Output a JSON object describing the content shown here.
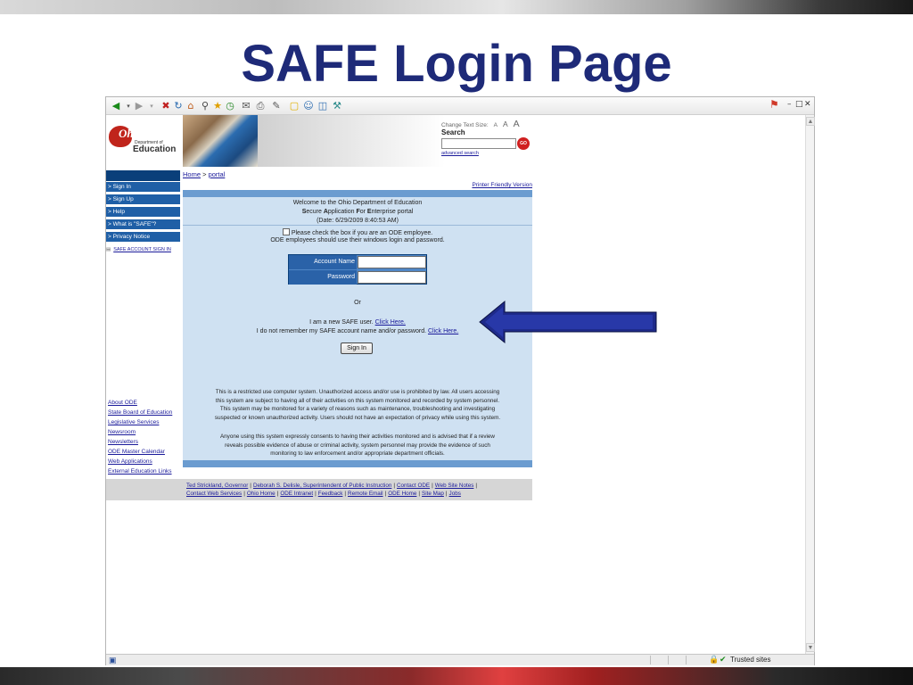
{
  "slide": {
    "title": "SAFE Login Page",
    "colors": {
      "title": "#1e2a78",
      "arrow": "#1e2a8a",
      "nav": "#1f5fa6",
      "content_bg": "#cfe1f2"
    }
  },
  "browser": {
    "toolbar_icons": [
      "back-icon",
      "forward-icon",
      "stop-icon",
      "refresh-icon",
      "home-icon",
      "search-icon",
      "favorites-icon",
      "history-icon",
      "mail-icon",
      "print-icon",
      "edit-icon",
      "discuss-icon",
      "messenger-icon"
    ],
    "status": {
      "zone": "Trusted sites"
    }
  },
  "header": {
    "logo": {
      "ohio": "Ohio",
      "dept": "Department of",
      "education": "Education"
    },
    "text_size_label": "Change Text Size:",
    "text_size_options": [
      "A",
      "A",
      "A"
    ],
    "search_label": "Search",
    "search_value": "",
    "go_label": "GO",
    "advanced_search": "advanced search"
  },
  "nav": {
    "items": [
      {
        "label": "> Sign In"
      },
      {
        "label": "> Sign Up"
      },
      {
        "label": "> Help"
      },
      {
        "label": "> What is \"SAFE\"?"
      },
      {
        "label": "> Privacy Notice"
      }
    ],
    "safe_account_signin": "SAFE ACCOUNT SIGN IN",
    "side_links": [
      "About ODE",
      "State Board of Education",
      "Legislative Services",
      "Newsroom",
      "Newsletters",
      "ODE Master Calendar",
      "Web Applications",
      "External Education Links"
    ]
  },
  "breadcrumb": {
    "home": "Home",
    "sep": " > ",
    "current": "portal"
  },
  "content": {
    "printer_friendly": "Printer Friendly Version",
    "welcome_line1": "Welcome to the Ohio Department of Education",
    "welcome_s": "S",
    "welcome_ecure": "ecure ",
    "welcome_a": "A",
    "welcome_pplication": "pplication ",
    "welcome_f": "F",
    "welcome_or": "or ",
    "welcome_e": "E",
    "welcome_nterprise": "nterprise portal",
    "welcome_date": "(Date: 6/29/2009 8:40:53 AM)",
    "checkbox_text": "Please check the box if you are an ODE employee.",
    "ode_employees_text": "ODE employees should use their windows login and password.",
    "account_name_label": "Account Name",
    "account_name_value": "",
    "password_label": "Password",
    "password_value": "",
    "or_text": "Or",
    "new_user_text": "I am a new SAFE user. ",
    "new_user_link": "Click Here.",
    "forgot_text": "I do not remember my SAFE account name and/or password. ",
    "forgot_link": "Click Here.",
    "signin_button": "Sign In",
    "notice_lines": [
      "This is a restricted use computer system. Unauthorized access and/or use is prohibited by law. All users accessing",
      "this system are subject to having all of their activities on this system monitored and recorded by system personnel.",
      "This system may be monitored for a variety of reasons such as maintenance, troubleshooting and investigating",
      "suspected or known unauthorized activity. Users should not have an expectation of privacy while using this system."
    ],
    "notice2_lines": [
      "Anyone using this system expressly consents to having their activities monitored and is advised that if a review",
      "reveals possible evidence of abuse or criminal activity, system personnel may provide the evidence of such",
      "monitoring to law enforcement and/or appropriate department officials."
    ]
  },
  "footer": {
    "row1": [
      "Ted Strickland, Governor",
      "Deborah S. Delisle, Superintendent of Public Instruction",
      "Contact ODE",
      "Web Site Notes"
    ],
    "row2": [
      "Contact Web Services",
      "Ohio Home",
      "ODE Intranet",
      "Feedback",
      "Remote Email",
      "ODE Home",
      "Site Map",
      "Jobs"
    ]
  }
}
